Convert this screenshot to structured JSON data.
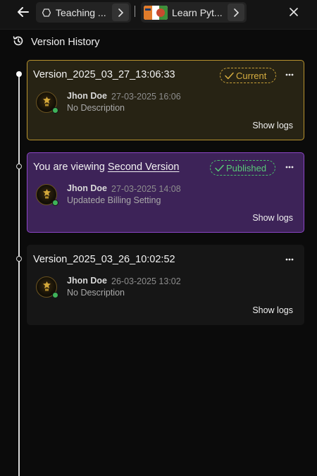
{
  "topbar": {
    "tab1": {
      "icon": "hexagon-icon",
      "label": "Teaching ..."
    },
    "tab2": {
      "icon": "course-thumbnail",
      "label": "Learn Pyt..."
    }
  },
  "header": {
    "icon": "history-icon",
    "title": "Version History"
  },
  "versions": [
    {
      "title": "Version_2025_03_27_13:06:33",
      "badge": "Current",
      "author": "Jhon Doe",
      "date": "27-03-2025 16:06",
      "description": "No Description",
      "action": "Show logs"
    },
    {
      "title_prefix": "You are viewing",
      "title_link": "Second Version",
      "badge": "Published",
      "author": "Jhon Doe",
      "date": "27-03-2025 14:08",
      "description": "Updatede Billing Setting",
      "action": "Show logs"
    },
    {
      "title": "Version_2025_03_26_10:02:52",
      "author": "Jhon Doe",
      "date": "26-03-2025 13:02",
      "description": "No Description",
      "action": "Show logs"
    }
  ],
  "colors": {
    "background": "#0b0b0b",
    "current_accent": "#c9a138",
    "published_accent": "#4cc06d",
    "viewing_card": "#3d2358",
    "viewing_border": "#8b45c6",
    "online_status": "#3fb35a"
  }
}
